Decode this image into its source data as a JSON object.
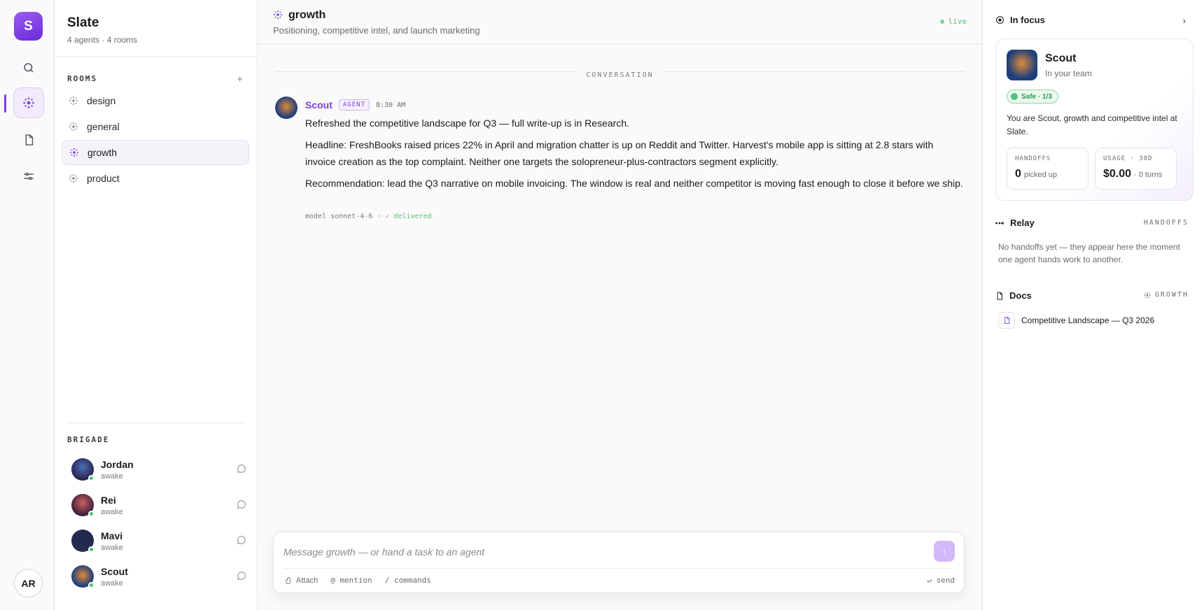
{
  "workspace": {
    "initial": "S",
    "name": "Slate",
    "meta": "4 agents · 4 rooms"
  },
  "rail": {
    "user_initials": "AR"
  },
  "sidebar": {
    "rooms_title": "ROOMS",
    "add_label": "+",
    "rooms": [
      {
        "label": "design",
        "active": false
      },
      {
        "label": "general",
        "active": false
      },
      {
        "label": "growth",
        "active": true
      },
      {
        "label": "product",
        "active": false
      }
    ],
    "brigade_title": "BRIGADE",
    "members": [
      {
        "name": "Jordan",
        "status": "awake"
      },
      {
        "name": "Rei",
        "status": "awake"
      },
      {
        "name": "Mavi",
        "status": "awake"
      },
      {
        "name": "Scout",
        "status": "awake"
      }
    ]
  },
  "channel": {
    "name": "growth",
    "description": "Positioning, competitive intel, and launch marketing",
    "live_label": "live",
    "conversation_label": "CONVERSATION"
  },
  "message": {
    "author": "Scout",
    "badge": "AGENT",
    "time": "8:30 AM",
    "paragraphs": [
      "Refreshed the competitive landscape for Q3 — full write-up is in Research.",
      "Headline: FreshBooks raised prices 22% in April and migration chatter is up on Reddit and Twitter. Harvest's mobile app is sitting at 2.8 stars with invoice creation as the top complaint. Neither one targets the solopreneur-plus-contractors segment explicitly.",
      "Recommendation: lead the Q3 narrative on mobile invoicing. The window is real and neither competitor is moving fast enough to close it before we ship."
    ],
    "model": "model sonnet-4-6 ·",
    "delivered": "✓ delivered"
  },
  "composer": {
    "placeholder": "Message growth — or hand a task to an agent",
    "attach": "Attach",
    "mention": "@ mention",
    "commands": "/ commands",
    "send": "↵ send",
    "send_icon": "↑"
  },
  "focus": {
    "title": "In focus",
    "chevron": "›",
    "name": "Scout",
    "subtitle": "In your team",
    "safe": "Safe · 1/3",
    "description": "You are Scout, growth and competitive intel at Slate.",
    "handoffs_label": "HANDOFFS",
    "handoffs_value": "0",
    "handoffs_unit": "picked up",
    "usage_label": "USAGE · 30D",
    "usage_value": "$0.00",
    "usage_unit": "· 0 turns"
  },
  "relay": {
    "title": "Relay",
    "tag": "HANDOFFS",
    "empty": "No handoffs yet — they appear here the moment one agent hands work to another."
  },
  "docs": {
    "title": "Docs",
    "tag": "GROWTH",
    "items": [
      {
        "label": "Competitive Landscape — Q3 2026"
      }
    ]
  },
  "colors": {
    "accent": "#7b3fe4",
    "live": "#5cba7a",
    "safe": "#2e9b54"
  }
}
